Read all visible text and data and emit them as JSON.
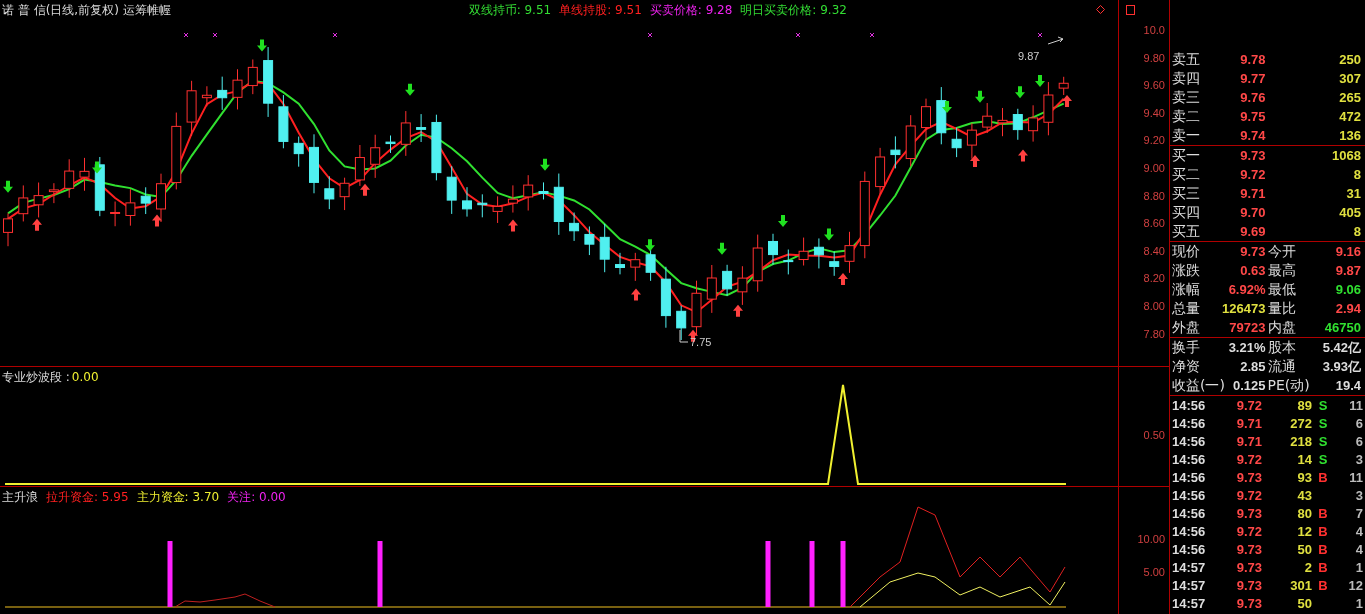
{
  "header": {
    "title": "诺 普 信(日线,前复权) 运筹帷幄",
    "legend": [
      {
        "label": "双线持币:",
        "value": "9.51",
        "color": "#33dd33"
      },
      {
        "label": "单线持股:",
        "value": "9.51",
        "color": "#ff2020"
      },
      {
        "label": "买卖价格:",
        "value": "9.28",
        "color": "#ee22ee"
      },
      {
        "label": "明日买卖价格:",
        "value": "9.32",
        "color": "#33dd33"
      }
    ]
  },
  "main_chart": {
    "price_axis": [
      "10.0",
      "9.80",
      "9.60",
      "9.40",
      "9.20",
      "9.00",
      "8.80",
      "8.60",
      "8.40",
      "8.20",
      "8.00",
      "7.80"
    ],
    "high_label": "9.87",
    "low_label": "7.75"
  },
  "indicator_1": {
    "label": "专业炒波段 :",
    "value": "0.00",
    "axis": [
      "0.50"
    ]
  },
  "indicator_2": {
    "name": "主升浪",
    "legend": [
      {
        "label": "拉升资金:",
        "value": "5.95",
        "color": "#ff2020"
      },
      {
        "label": "主力资金:",
        "value": "3.70",
        "color": "#eeee30"
      },
      {
        "label": "关注:",
        "value": "0.00",
        "color": "#ee22ee"
      }
    ],
    "axis": [
      "10.00",
      "5.00"
    ]
  },
  "order_book": {
    "asks": [
      {
        "label": "卖五",
        "price": "9.78",
        "volume": "250"
      },
      {
        "label": "卖四",
        "price": "9.77",
        "volume": "307"
      },
      {
        "label": "卖三",
        "price": "9.76",
        "volume": "265"
      },
      {
        "label": "卖二",
        "price": "9.75",
        "volume": "472"
      },
      {
        "label": "卖一",
        "price": "9.74",
        "volume": "136"
      }
    ],
    "bids": [
      {
        "label": "买一",
        "price": "9.73",
        "volume": "1068"
      },
      {
        "label": "买二",
        "price": "9.72",
        "volume": "8"
      },
      {
        "label": "买三",
        "price": "9.71",
        "volume": "31"
      },
      {
        "label": "买四",
        "price": "9.70",
        "volume": "405"
      },
      {
        "label": "买五",
        "price": "9.69",
        "volume": "8"
      }
    ]
  },
  "quote": [
    {
      "label": "现价",
      "value": "9.73",
      "kind": "up"
    },
    {
      "label": "今开",
      "value": "9.16",
      "kind": "up"
    },
    {
      "label": "涨跌",
      "value": "0.63",
      "kind": "up"
    },
    {
      "label": "最高",
      "value": "9.87",
      "kind": "up"
    },
    {
      "label": "涨幅",
      "value": "6.92%",
      "kind": "up"
    },
    {
      "label": "最低",
      "value": "9.06",
      "kind": "down"
    },
    {
      "label": "总量",
      "value": "126473",
      "kind": "volume"
    },
    {
      "label": "量比",
      "value": "2.94",
      "kind": "up"
    },
    {
      "label": "外盘",
      "value": "79723",
      "kind": "up"
    },
    {
      "label": "内盘",
      "value": "46750",
      "kind": "down"
    }
  ],
  "fundamentals": [
    {
      "label": "换手",
      "value": "3.21%",
      "kind": "plain"
    },
    {
      "label": "股本",
      "value": "5.42亿",
      "kind": "plain"
    },
    {
      "label": "净资",
      "value": "2.85",
      "kind": "plain"
    },
    {
      "label": "流通",
      "value": "3.93亿",
      "kind": "plain"
    },
    {
      "label": "收益(一)",
      "value": "0.125",
      "kind": "plain"
    },
    {
      "label": "PE(动)",
      "value": "19.4",
      "kind": "plain"
    }
  ],
  "trades": [
    {
      "time": "14:56",
      "price": "9.72",
      "volume": "89",
      "side": "S",
      "kind": "sell",
      "count": "11"
    },
    {
      "time": "14:56",
      "price": "9.71",
      "volume": "272",
      "side": "S",
      "kind": "sell",
      "count": "6"
    },
    {
      "time": "14:56",
      "price": "9.71",
      "volume": "218",
      "side": "S",
      "kind": "sell",
      "count": "6"
    },
    {
      "time": "14:56",
      "price": "9.72",
      "volume": "14",
      "side": "S",
      "kind": "sell",
      "count": "3"
    },
    {
      "time": "14:56",
      "price": "9.73",
      "volume": "93",
      "side": "B",
      "kind": "buy",
      "count": "11"
    },
    {
      "time": "14:56",
      "price": "9.72",
      "volume": "43",
      "count": "3"
    },
    {
      "time": "14:56",
      "price": "9.73",
      "volume": "80",
      "side": "B",
      "kind": "buy",
      "count": "7"
    },
    {
      "time": "14:56",
      "price": "9.72",
      "volume": "12",
      "side": "B",
      "kind": "buy",
      "count": "4"
    },
    {
      "time": "14:56",
      "price": "9.73",
      "volume": "50",
      "side": "B",
      "kind": "buy",
      "count": "4"
    },
    {
      "time": "14:57",
      "price": "9.73",
      "volume": "2",
      "side": "B",
      "kind": "buy",
      "count": "1"
    },
    {
      "time": "14:57",
      "price": "9.73",
      "volume": "301",
      "side": "B",
      "kind": "buy",
      "count": "12"
    },
    {
      "time": "14:57",
      "price": "9.73",
      "volume": "50",
      "count": "1"
    }
  ]
}
